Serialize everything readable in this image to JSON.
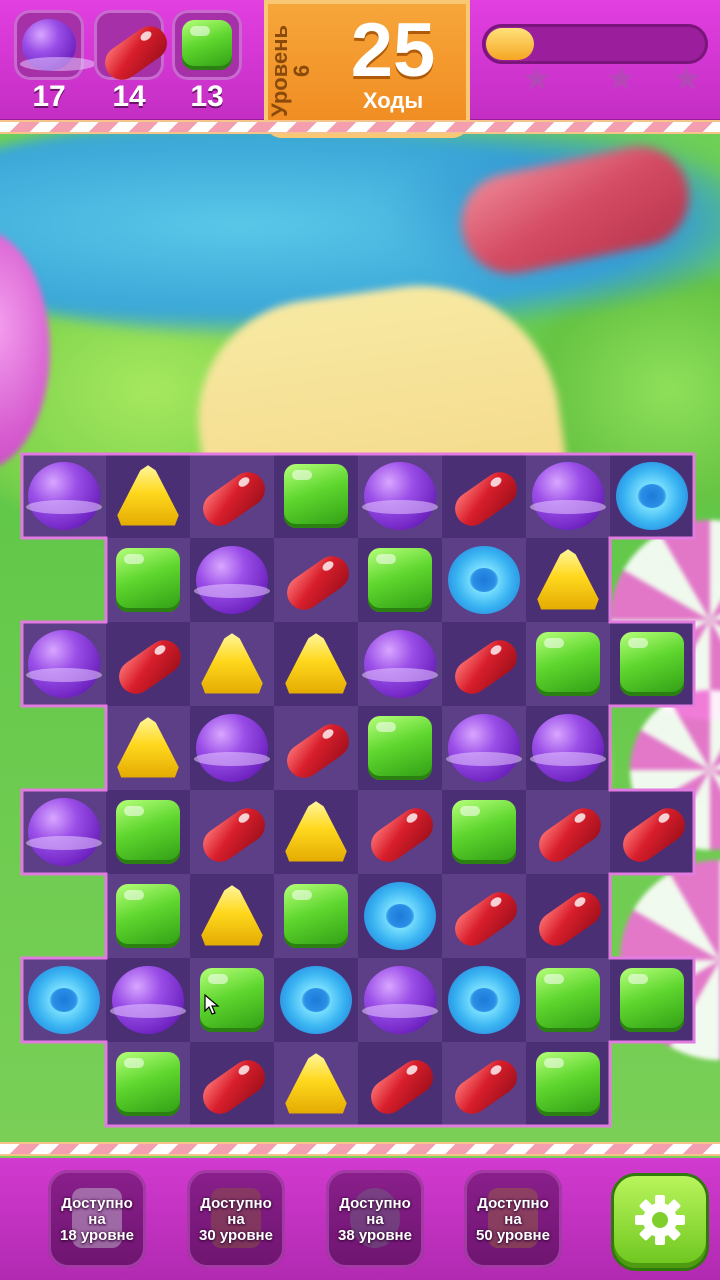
{
  "goals": [
    {
      "candy": "purple",
      "count": "17"
    },
    {
      "candy": "red",
      "count": "14"
    },
    {
      "candy": "green",
      "count": "13"
    }
  ],
  "level": {
    "label": "Уровень 6"
  },
  "moves": {
    "number": "25",
    "label": "Ходы"
  },
  "score_progress": {
    "fill_fraction": 0.22,
    "stars": 3
  },
  "board": {
    "rows": [
      [
        "purple",
        "yellow",
        "red",
        "green",
        "purple",
        "red",
        "purple",
        "blue"
      ],
      [
        null,
        "green",
        "purple",
        "red",
        "green",
        "blue",
        "yellow",
        null
      ],
      [
        "purple",
        "red",
        "yellow",
        "yellow",
        "purple",
        "red",
        "green",
        "green"
      ],
      [
        null,
        "yellow",
        "purple",
        "red",
        "green",
        "purple",
        "purple",
        null
      ],
      [
        "purple",
        "green",
        "red",
        "yellow",
        "red",
        "green",
        "red",
        "red"
      ],
      [
        null,
        "green",
        "yellow",
        "green",
        "blue",
        "red",
        "red",
        null
      ],
      [
        "blue",
        "purple",
        "green",
        "blue",
        "purple",
        "blue",
        "green",
        "green"
      ],
      [
        null,
        "green",
        "red",
        "yellow",
        "red",
        "red",
        "green",
        null
      ]
    ]
  },
  "boosters": [
    {
      "line1": "Доступно",
      "line2": "на",
      "line3": "18 уровне",
      "icon": "hammer-icon"
    },
    {
      "line1": "Доступно",
      "line2": "на",
      "line3": "30 уровне",
      "icon": "bomb-icon"
    },
    {
      "line1": "Доступно",
      "line2": "на",
      "line3": "38 уровне",
      "icon": "swap-icon"
    },
    {
      "line1": "Доступно",
      "line2": "на",
      "line3": "50 уровне",
      "icon": "bag-icon"
    }
  ],
  "settings": {
    "icon": "gear-icon"
  },
  "colors": {
    "topbar": "#d236d0",
    "level_panel": "#f39b2e",
    "board_dark": "#4a2f74",
    "board_light": "#5c3f86",
    "settings_button": "#8bd83a"
  }
}
